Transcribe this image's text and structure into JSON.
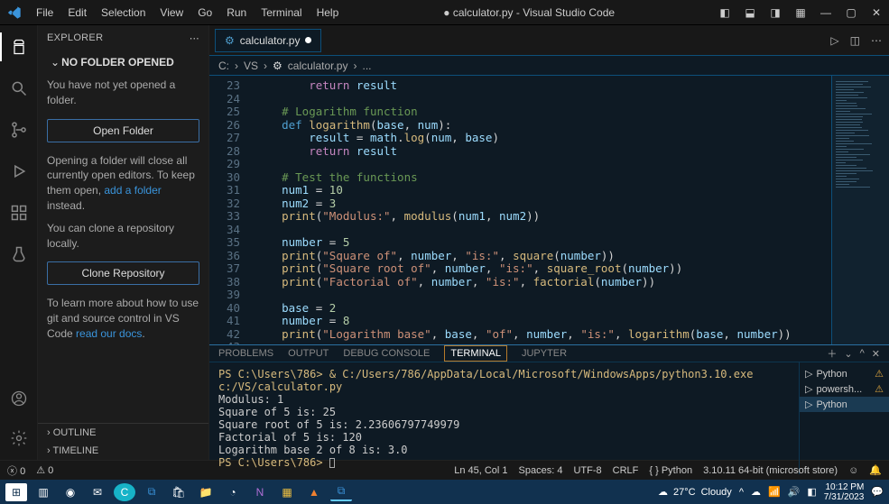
{
  "title": "calculator.py - Visual Studio Code",
  "title_dirty_prefix": "●",
  "menu": [
    "File",
    "Edit",
    "Selection",
    "View",
    "Go",
    "Run",
    "Terminal",
    "Help"
  ],
  "activity_icons": [
    "files",
    "search",
    "git",
    "debug",
    "extensions",
    "test"
  ],
  "sidebar": {
    "header": "EXPLORER",
    "section": "NO FOLDER OPENED",
    "not_opened": "You have not yet opened a folder.",
    "open_btn": "Open Folder",
    "close_info_a": "Opening a folder will close all currently open editors. To keep them open, ",
    "close_info_link": "add a folder",
    "close_info_b": " instead.",
    "clone_info": "You can clone a repository locally.",
    "clone_btn": "Clone Repository",
    "learn_a": "To learn more about how to use git and source control in VS Code ",
    "learn_link": "read our docs",
    "learn_b": ".",
    "outline": "OUTLINE",
    "timeline": "TIMELINE"
  },
  "tab": {
    "name": "calculator.py"
  },
  "breadcrumb": {
    "a": "C:",
    "b": "VS",
    "c": "calculator.py",
    "d": "..."
  },
  "code_start_line": 23,
  "code_lines": [
    [
      [
        "pl",
        "        "
      ],
      [
        "rt",
        "return"
      ],
      [
        "pl",
        " "
      ],
      [
        "id",
        "result"
      ]
    ],
    [],
    [
      [
        "pl",
        "    "
      ],
      [
        "cm",
        "# Logarithm function"
      ]
    ],
    [
      [
        "pl",
        "    "
      ],
      [
        "kw",
        "def"
      ],
      [
        "pl",
        " "
      ],
      [
        "fn",
        "logarithm"
      ],
      [
        "pl",
        "("
      ],
      [
        "id",
        "base"
      ],
      [
        "pl",
        ", "
      ],
      [
        "id",
        "num"
      ],
      [
        "pl",
        "):"
      ]
    ],
    [
      [
        "pl",
        "        "
      ],
      [
        "id",
        "result"
      ],
      [
        "pl",
        " = "
      ],
      [
        "id",
        "math"
      ],
      [
        "pl",
        "."
      ],
      [
        "fn",
        "log"
      ],
      [
        "pl",
        "("
      ],
      [
        "id",
        "num"
      ],
      [
        "pl",
        ", "
      ],
      [
        "id",
        "base"
      ],
      [
        "pl",
        ")"
      ]
    ],
    [
      [
        "pl",
        "        "
      ],
      [
        "rt",
        "return"
      ],
      [
        "pl",
        " "
      ],
      [
        "id",
        "result"
      ]
    ],
    [],
    [
      [
        "pl",
        "    "
      ],
      [
        "cm",
        "# Test the functions"
      ]
    ],
    [
      [
        "pl",
        "    "
      ],
      [
        "id",
        "num1"
      ],
      [
        "pl",
        " = "
      ],
      [
        "num",
        "10"
      ]
    ],
    [
      [
        "pl",
        "    "
      ],
      [
        "id",
        "num2"
      ],
      [
        "pl",
        " = "
      ],
      [
        "num",
        "3"
      ]
    ],
    [
      [
        "pl",
        "    "
      ],
      [
        "fn",
        "print"
      ],
      [
        "pl",
        "("
      ],
      [
        "str",
        "\"Modulus:\""
      ],
      [
        "pl",
        ", "
      ],
      [
        "fn",
        "modulus"
      ],
      [
        "pl",
        "("
      ],
      [
        "id",
        "num1"
      ],
      [
        "pl",
        ", "
      ],
      [
        "id",
        "num2"
      ],
      [
        "pl",
        "))"
      ]
    ],
    [],
    [
      [
        "pl",
        "    "
      ],
      [
        "id",
        "number"
      ],
      [
        "pl",
        " = "
      ],
      [
        "num",
        "5"
      ]
    ],
    [
      [
        "pl",
        "    "
      ],
      [
        "fn",
        "print"
      ],
      [
        "pl",
        "("
      ],
      [
        "str",
        "\"Square of\""
      ],
      [
        "pl",
        ", "
      ],
      [
        "id",
        "number"
      ],
      [
        "pl",
        ", "
      ],
      [
        "str",
        "\"is:\""
      ],
      [
        "pl",
        ", "
      ],
      [
        "fn",
        "square"
      ],
      [
        "pl",
        "("
      ],
      [
        "id",
        "number"
      ],
      [
        "pl",
        "))"
      ]
    ],
    [
      [
        "pl",
        "    "
      ],
      [
        "fn",
        "print"
      ],
      [
        "pl",
        "("
      ],
      [
        "str",
        "\"Square root of\""
      ],
      [
        "pl",
        ", "
      ],
      [
        "id",
        "number"
      ],
      [
        "pl",
        ", "
      ],
      [
        "str",
        "\"is:\""
      ],
      [
        "pl",
        ", "
      ],
      [
        "fn",
        "square_root"
      ],
      [
        "pl",
        "("
      ],
      [
        "id",
        "number"
      ],
      [
        "pl",
        "))"
      ]
    ],
    [
      [
        "pl",
        "    "
      ],
      [
        "fn",
        "print"
      ],
      [
        "pl",
        "("
      ],
      [
        "str",
        "\"Factorial of\""
      ],
      [
        "pl",
        ", "
      ],
      [
        "id",
        "number"
      ],
      [
        "pl",
        ", "
      ],
      [
        "str",
        "\"is:\""
      ],
      [
        "pl",
        ", "
      ],
      [
        "fn",
        "factorial"
      ],
      [
        "pl",
        "("
      ],
      [
        "id",
        "number"
      ],
      [
        "pl",
        "))"
      ]
    ],
    [],
    [
      [
        "pl",
        "    "
      ],
      [
        "id",
        "base"
      ],
      [
        "pl",
        " = "
      ],
      [
        "num",
        "2"
      ]
    ],
    [
      [
        "pl",
        "    "
      ],
      [
        "id",
        "number"
      ],
      [
        "pl",
        " = "
      ],
      [
        "num",
        "8"
      ]
    ],
    [
      [
        "pl",
        "    "
      ],
      [
        "fn",
        "print"
      ],
      [
        "pl",
        "("
      ],
      [
        "str",
        "\"Logarithm base\""
      ],
      [
        "pl",
        ", "
      ],
      [
        "id",
        "base"
      ],
      [
        "pl",
        ", "
      ],
      [
        "str",
        "\"of\""
      ],
      [
        "pl",
        ", "
      ],
      [
        "id",
        "number"
      ],
      [
        "pl",
        ", "
      ],
      [
        "str",
        "\"is:\""
      ],
      [
        "pl",
        ", "
      ],
      [
        "fn",
        "logarithm"
      ],
      [
        "pl",
        "("
      ],
      [
        "id",
        "base"
      ],
      [
        "pl",
        ", "
      ],
      [
        "id",
        "number"
      ],
      [
        "pl",
        "))"
      ]
    ],
    []
  ],
  "panel": {
    "tabs": {
      "problems": "PROBLEMS",
      "output": "OUTPUT",
      "debug": "DEBUG CONSOLE",
      "terminal": "TERMINAL",
      "jupyter": "JUPYTER"
    },
    "terminal_lines": [
      {
        "prompt": "PS C:\\Users\\786> ",
        "cmd": "& C:/Users/786/AppData/Local/Microsoft/WindowsApps/python3.10.exe c:/VS/calculator.py"
      },
      {
        "text": "Modulus: 1"
      },
      {
        "text": "Square of 5 is: 25"
      },
      {
        "text": "Square root of 5 is: 2.23606797749979"
      },
      {
        "text": "Factorial of 5 is: 120"
      },
      {
        "text": "Logarithm base 2 of 8 is: 3.0"
      },
      {
        "prompt": "PS C:\\Users\\786> ",
        "cursor": true
      }
    ],
    "side": [
      {
        "icon": "py",
        "label": "Python",
        "warn": true
      },
      {
        "icon": "ps",
        "label": "powersh...",
        "warn": true
      },
      {
        "icon": "py",
        "label": "Python",
        "active": true
      }
    ]
  },
  "status": {
    "left": {
      "remote": "",
      "errors": "0",
      "warnings": "0"
    },
    "right": {
      "pos": "Ln 45, Col 1",
      "spaces": "Spaces: 4",
      "enc": "UTF-8",
      "eol": "CRLF",
      "lang": "Python",
      "ver": "3.10.11 64-bit (microsoft store)"
    }
  },
  "taskbar": {
    "weather": {
      "temp": "27°C",
      "desc": "Cloudy"
    },
    "time": "10:12 PM",
    "date": "7/31/2023"
  }
}
